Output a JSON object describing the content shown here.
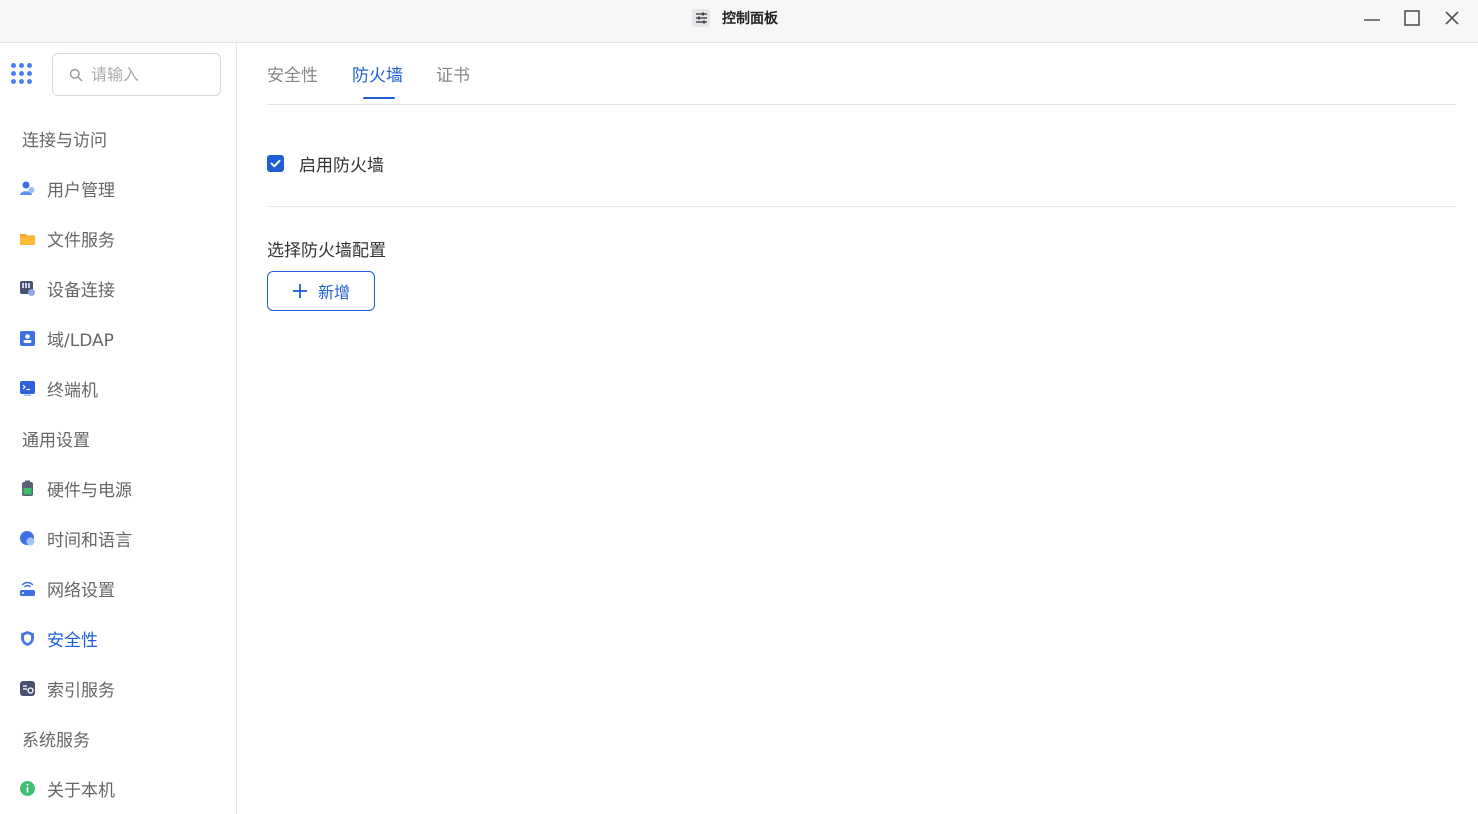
{
  "window": {
    "title": "控制面板",
    "title_icon": "sliders-icon",
    "controls": [
      "minimize-icon",
      "maximize-icon",
      "close-icon"
    ]
  },
  "sidebar": {
    "apps_icon": "apps-grid-icon",
    "search": {
      "placeholder": "请输入",
      "value": ""
    },
    "sections": [
      {
        "title": "连接与访问",
        "items": [
          {
            "label": "用户管理",
            "icon": "users-icon"
          },
          {
            "label": "文件服务",
            "icon": "folder-icon"
          },
          {
            "label": "设备连接",
            "icon": "device-link-icon"
          },
          {
            "label": "域/LDAP",
            "icon": "ldap-icon"
          },
          {
            "label": "终端机",
            "icon": "terminal-icon"
          }
        ]
      },
      {
        "title": "通用设置",
        "items": [
          {
            "label": "硬件与电源",
            "icon": "battery-icon"
          },
          {
            "label": "时间和语言",
            "icon": "globe-icon"
          },
          {
            "label": "网络设置",
            "icon": "router-icon"
          },
          {
            "label": "安全性",
            "icon": "shield-icon",
            "active": true
          },
          {
            "label": "索引服务",
            "icon": "index-icon"
          }
        ]
      },
      {
        "title": "系统服务",
        "items": [
          {
            "label": "关于本机",
            "icon": "info-icon"
          }
        ]
      }
    ]
  },
  "main": {
    "tabs": [
      {
        "label": "安全性"
      },
      {
        "label": "防火墙",
        "active": true
      },
      {
        "label": "证书"
      }
    ],
    "firewall": {
      "enable_label": "启用防火墙",
      "enabled": true,
      "config_title": "选择防火墙配置",
      "add_label": "新增"
    }
  },
  "colors": {
    "accent": "#1f5fd6",
    "text": "#333333",
    "muted": "#666666",
    "border": "#e3e3e6"
  }
}
